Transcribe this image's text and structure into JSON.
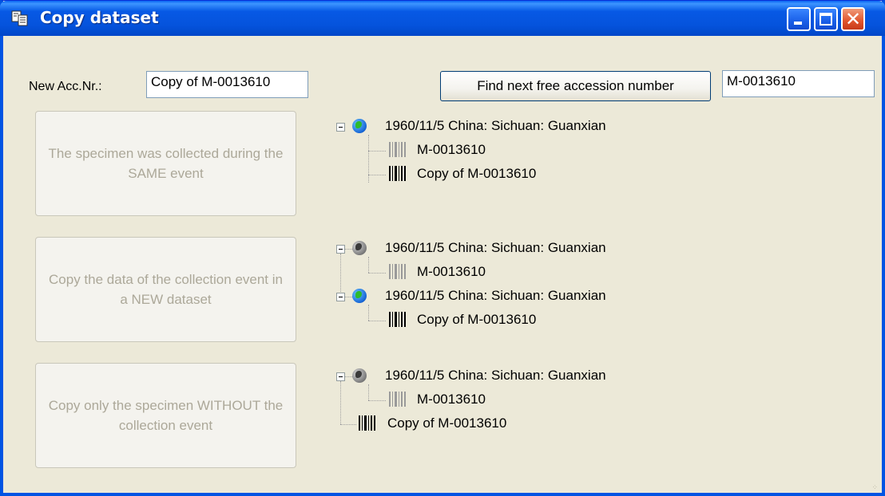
{
  "window": {
    "title": "Copy dataset",
    "icons": {
      "app": "copy-document-icon",
      "minimize": "minimize-icon",
      "maximize": "maximize-icon",
      "close": "close-icon"
    },
    "close_glyph": "✕"
  },
  "form": {
    "new_acc_label": "New Acc.Nr.:",
    "new_acc_value": "Copy of M-0013610",
    "find_button_label": "Find next free accession number",
    "original_acc_value": "M-0013610"
  },
  "options": [
    {
      "button_label": "The specimen was collected during the SAME event",
      "tree": [
        {
          "type": "event",
          "globe": "color",
          "label": "1960/11/5 China: Sichuan: Guanxian"
        },
        {
          "type": "specimen",
          "barcode": "gray",
          "label": "M-0013610"
        },
        {
          "type": "specimen",
          "barcode": "black",
          "label": "Copy of M-0013610"
        }
      ]
    },
    {
      "button_label": "Copy the data of the collection event in a NEW dataset",
      "tree": [
        {
          "type": "event",
          "globe": "gray",
          "label": "1960/11/5 China: Sichuan: Guanxian"
        },
        {
          "type": "specimen",
          "barcode": "gray",
          "label": "M-0013610"
        },
        {
          "type": "event",
          "globe": "color",
          "label": "1960/11/5 China: Sichuan: Guanxian"
        },
        {
          "type": "specimen",
          "barcode": "black",
          "label": "Copy of M-0013610"
        }
      ]
    },
    {
      "button_label": "Copy only the specimen WITHOUT the collection event",
      "tree": [
        {
          "type": "event",
          "globe": "gray",
          "label": "1960/11/5 China: Sichuan: Guanxian"
        },
        {
          "type": "specimen",
          "barcode": "gray",
          "label": "M-0013610"
        },
        {
          "type": "specimen",
          "barcode": "black",
          "label": "Copy of M-0013610"
        }
      ]
    }
  ],
  "colors": {
    "titlebar": "#0054E3",
    "dialog_bg": "#ECE9D8",
    "disabled_text": "#ACA899"
  }
}
